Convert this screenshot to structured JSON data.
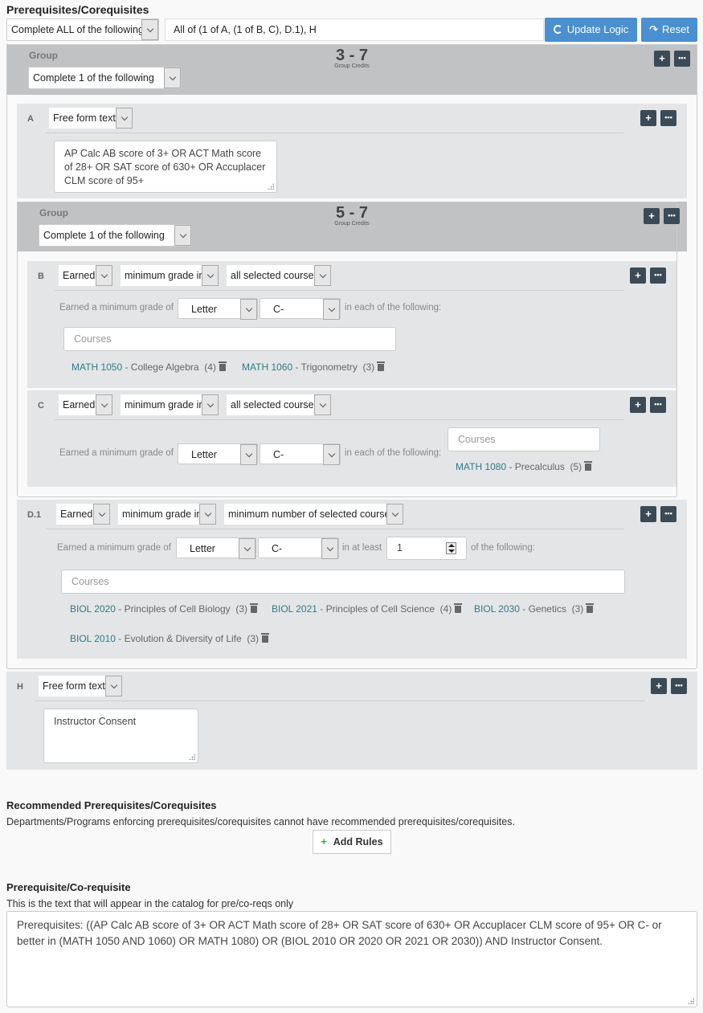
{
  "section_title": "Prerequisites/Corequisites",
  "top": {
    "logic_select": "Complete ALL of the following",
    "logic_expression": "All of (1 of A, (1 of B, C), D.1), H",
    "update_logic_label": "Update Logic",
    "reset_label": "Reset"
  },
  "outer_group": {
    "label": "Group",
    "select": "Complete 1 of the following",
    "credits": "3 - 7",
    "credits_label": "Group Credits"
  },
  "rule_a": {
    "letter": "A",
    "type": "Free form text",
    "text": "AP Calc AB score of 3+ OR ACT Math score of 28+ OR SAT score of 630+ OR Accuplacer CLM score of 95+"
  },
  "inner_group": {
    "label": "Group",
    "select": "Complete 1 of the following",
    "credits": "5 - 7",
    "credits_label": "Group Credits"
  },
  "rule_b": {
    "letter": "B",
    "sel1": "Earned",
    "sel2": "minimum grade in",
    "sel3": "all selected courses",
    "prefix": "Earned a minimum grade of",
    "grade_type": "Letter",
    "grade": "C-",
    "suffix": "in each of the following:",
    "courses_placeholder": "Courses",
    "courses": [
      {
        "code": "MATH 1050",
        "title": " - College Algebra",
        "credits": "(4)"
      },
      {
        "code": "MATH 1060",
        "title": " - Trigonometry",
        "credits": "(3)"
      }
    ]
  },
  "rule_c": {
    "letter": "C",
    "sel1": "Earned",
    "sel2": "minimum grade in",
    "sel3": "all selected courses",
    "prefix": "Earned a minimum grade of",
    "grade_type": "Letter",
    "grade": "C-",
    "suffix": "in each of the following:",
    "courses_placeholder": "Courses",
    "courses": [
      {
        "code": "MATH 1080",
        "title": " - Precalculus",
        "credits": "(5)"
      }
    ]
  },
  "rule_d1": {
    "letter": "D.1",
    "sel1": "Earned",
    "sel2": "minimum grade in",
    "sel3": "minimum number of selected courses",
    "prefix": "Earned a minimum grade of",
    "grade_type": "Letter",
    "grade": "C-",
    "at_least_label": "in at least",
    "at_least_value": "1",
    "suffix": "of the following:",
    "courses_placeholder": "Courses",
    "courses": [
      {
        "code": "BIOL 2020",
        "title": " - Principles of Cell Biology",
        "credits": "(3)"
      },
      {
        "code": "BIOL 2021",
        "title": " - Principles of Cell Science",
        "credits": "(4)"
      },
      {
        "code": "BIOL 2030",
        "title": " - Genetics",
        "credits": "(3)"
      },
      {
        "code": "BIOL 2010",
        "title": " - Evolution & Diversity of Life",
        "credits": "(3)"
      }
    ]
  },
  "rule_h": {
    "letter": "H",
    "type": "Free form text",
    "text": "Instructor Consent"
  },
  "recommended": {
    "title": "Recommended Prerequisites/Corequisites",
    "description": "Departments/Programs enforcing prerequisites/corequisites cannot have recommended prerequisites/corequisites.",
    "add_rules_label": "Add Rules"
  },
  "catalog": {
    "title": "Prerequisite/Co-requisite",
    "description": "This is the text that will appear in the catalog for pre/co-reqs only",
    "text": "Prerequisites: ((AP Calc AB score of 3+ OR ACT Math score of 28+ OR SAT score of 630+ OR Accuplacer CLM score of 95+ OR C- or better in (MATH 1050 AND 1060) OR MATH 1080) OR (BIOL 2010 OR 2020 OR 2021 OR 2030)) AND Instructor Consent."
  },
  "colors": {
    "primary_button": "#4a8fd0",
    "icon_button": "#3b4a57",
    "course_link": "#2f7a8c",
    "add_icon": "#3aa84a"
  }
}
